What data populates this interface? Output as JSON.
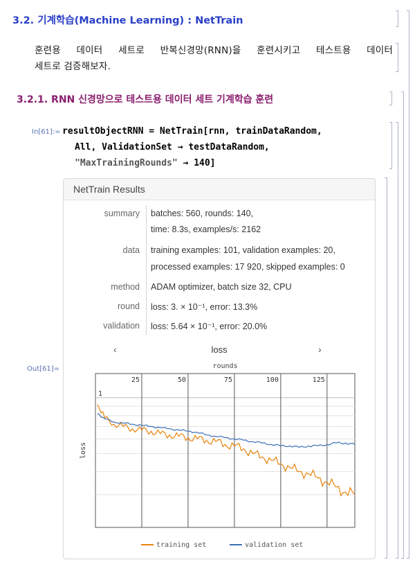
{
  "section": {
    "number_title": "3.2. 기계학습(Machine Learning) : NetTrain"
  },
  "paragraph": {
    "line1": "훈련용 데이터 세트로 반복신경망(RNN)을 훈련시키고 테스트용 데이터",
    "line2": "세트로 검증해보자."
  },
  "subsection": {
    "title": "3.2.1. RNN 신경망으로 테스트용 데이터 세트 기계학습 훈련"
  },
  "input_cell": {
    "label": "In[61]:=",
    "line1": "resultObjectRNN = NetTrain[rnn, trainDataRandom,",
    "line2": "All, ValidationSet → testDataRandom,",
    "line3_str": "\"MaxTrainingRounds\"",
    "line3_rest": " → 140]"
  },
  "output_cell": {
    "label": "Out[61]="
  },
  "results": {
    "title": "NetTrain Results",
    "rows": [
      {
        "key": "summary",
        "lines": [
          "batches: 560, rounds: 140,",
          "time: 8.3s, examples/s: 2162"
        ]
      },
      {
        "key": "data",
        "lines": [
          "training examples: 101, validation examples: 20,",
          "processed examples: 17 920, skipped examples: 0"
        ]
      },
      {
        "key": "method",
        "lines": [
          "ADAM optimizer, batch size 32, CPU"
        ]
      },
      {
        "key": "round",
        "lines": [
          "loss: 3. × 10⁻¹, error: 13.3%"
        ]
      },
      {
        "key": "validation",
        "lines": [
          "loss: 5.64 × 10⁻¹, error: 20.0%"
        ]
      }
    ],
    "nav": {
      "prev": "‹",
      "label": "loss",
      "next": "›"
    }
  },
  "chart_data": {
    "type": "line",
    "title": "rounds",
    "xlabel": "rounds",
    "ylabel": "loss",
    "xlim": [
      0,
      140
    ],
    "x_ticks": [
      "25",
      "50",
      "75",
      "100",
      "125"
    ],
    "y_tick_label": "1",
    "log_scale_y": true,
    "legend_position": "bottom",
    "series": [
      {
        "name": "training set",
        "color": "#e8820c",
        "x": [
          1,
          5,
          10,
          15,
          20,
          25,
          30,
          35,
          40,
          45,
          50,
          55,
          60,
          65,
          70,
          75,
          80,
          85,
          90,
          95,
          100,
          105,
          110,
          115,
          120,
          125,
          130,
          135,
          140
        ],
        "values": [
          0.92,
          0.78,
          0.72,
          0.7,
          0.68,
          0.67,
          0.66,
          0.64,
          0.63,
          0.62,
          0.61,
          0.6,
          0.59,
          0.58,
          0.56,
          0.55,
          0.53,
          0.5,
          0.48,
          0.46,
          0.44,
          0.42,
          0.4,
          0.39,
          0.37,
          0.35,
          0.33,
          0.31,
          0.3
        ]
      },
      {
        "name": "validation set",
        "color": "#3b6fb6",
        "x": [
          1,
          5,
          10,
          15,
          20,
          25,
          30,
          35,
          40,
          45,
          50,
          55,
          60,
          65,
          70,
          75,
          80,
          85,
          90,
          95,
          100,
          105,
          110,
          115,
          120,
          125,
          130,
          135,
          140
        ],
        "values": [
          0.82,
          0.77,
          0.74,
          0.73,
          0.72,
          0.71,
          0.7,
          0.69,
          0.68,
          0.67,
          0.66,
          0.65,
          0.63,
          0.62,
          0.61,
          0.6,
          0.59,
          0.58,
          0.57,
          0.56,
          0.55,
          0.55,
          0.54,
          0.55,
          0.55,
          0.56,
          0.57,
          0.57,
          0.56
        ]
      }
    ]
  }
}
